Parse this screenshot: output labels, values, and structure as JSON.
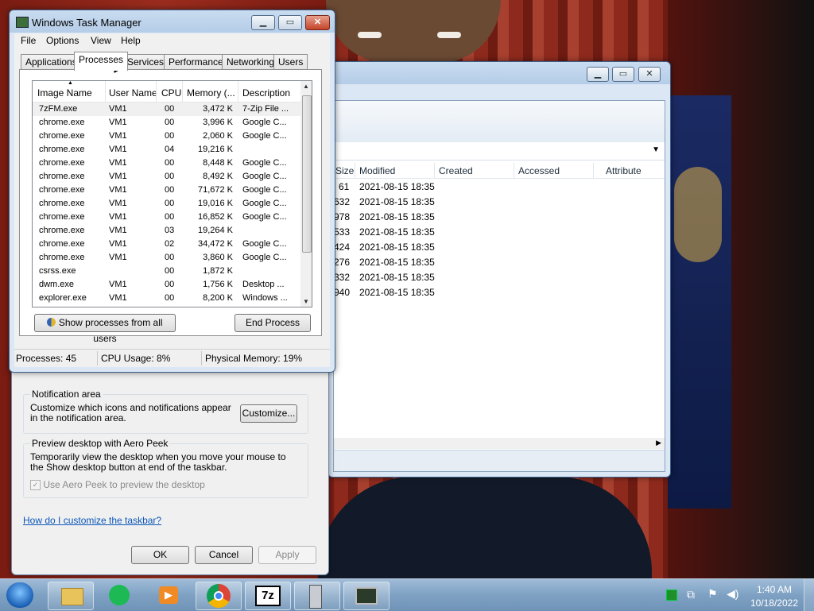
{
  "explorer": {
    "columns": [
      "Size",
      "Modified",
      "Created",
      "Accessed",
      "Attribute"
    ],
    "rows": [
      {
        "size": "61",
        "modified": "2021-08-15 18:35"
      },
      {
        "size": "632",
        "modified": "2021-08-15 18:35"
      },
      {
        "size": "978",
        "modified": "2021-08-15 18:35"
      },
      {
        "size": "533",
        "modified": "2021-08-15 18:35"
      },
      {
        "size": "424",
        "modified": "2021-08-15 18:35"
      },
      {
        "size": "276",
        "modified": "2021-08-15 18:35"
      },
      {
        "size": "332",
        "modified": "2021-08-15 18:35"
      },
      {
        "size": "940",
        "modified": "2021-08-15 18:35"
      }
    ]
  },
  "props": {
    "notification": {
      "label": "Notification area",
      "text": "Customize which icons and notifications appear in the notification area.",
      "button": "Customize..."
    },
    "peek": {
      "label": "Preview desktop with Aero Peek",
      "text": "Temporarily view the desktop when you move your mouse to the Show desktop button at end of the taskbar.",
      "checkbox": "Use Aero Peek to preview the desktop"
    },
    "help_link": "How do I customize the taskbar?",
    "ok": "OK",
    "cancel": "Cancel",
    "apply": "Apply"
  },
  "tm": {
    "title": "Windows Task Manager",
    "menu": [
      "File",
      "Options",
      "View",
      "Help"
    ],
    "tabs": [
      "Applications",
      "Processes",
      "Services",
      "Performance",
      "Networking",
      "Users"
    ],
    "columns": [
      "Image Name",
      "User Name",
      "CPU",
      "Memory (...",
      "Description"
    ],
    "processes": [
      {
        "name": "7zFM.exe",
        "user": "VM1",
        "cpu": "00",
        "mem": "3,472 K",
        "desc": "7-Zip File ..."
      },
      {
        "name": "chrome.exe",
        "user": "VM1",
        "cpu": "00",
        "mem": "3,996 K",
        "desc": "Google C..."
      },
      {
        "name": "chrome.exe",
        "user": "VM1",
        "cpu": "00",
        "mem": "2,060 K",
        "desc": "Google C..."
      },
      {
        "name": "chrome.exe",
        "user": "VM1",
        "cpu": "04",
        "mem": "19,216 K",
        "desc": ""
      },
      {
        "name": "chrome.exe",
        "user": "VM1",
        "cpu": "00",
        "mem": "8,448 K",
        "desc": "Google C..."
      },
      {
        "name": "chrome.exe",
        "user": "VM1",
        "cpu": "00",
        "mem": "8,492 K",
        "desc": "Google C..."
      },
      {
        "name": "chrome.exe",
        "user": "VM1",
        "cpu": "00",
        "mem": "71,672 K",
        "desc": "Google C..."
      },
      {
        "name": "chrome.exe",
        "user": "VM1",
        "cpu": "00",
        "mem": "19,016 K",
        "desc": "Google C..."
      },
      {
        "name": "chrome.exe",
        "user": "VM1",
        "cpu": "00",
        "mem": "16,852 K",
        "desc": "Google C..."
      },
      {
        "name": "chrome.exe",
        "user": "VM1",
        "cpu": "03",
        "mem": "19,264 K",
        "desc": ""
      },
      {
        "name": "chrome.exe",
        "user": "VM1",
        "cpu": "02",
        "mem": "34,472 K",
        "desc": "Google C..."
      },
      {
        "name": "chrome.exe",
        "user": "VM1",
        "cpu": "00",
        "mem": "3,860 K",
        "desc": "Google C..."
      },
      {
        "name": "csrss.exe",
        "user": "",
        "cpu": "00",
        "mem": "1,872 K",
        "desc": ""
      },
      {
        "name": "dwm.exe",
        "user": "VM1",
        "cpu": "00",
        "mem": "1,756 K",
        "desc": "Desktop ..."
      },
      {
        "name": "explorer.exe",
        "user": "VM1",
        "cpu": "00",
        "mem": "8,200 K",
        "desc": "Windows ..."
      }
    ],
    "show_all_button": "Show processes from all users",
    "end_process_button": "End Process",
    "status": {
      "processes": "Processes: 45",
      "cpu": "CPU Usage: 8%",
      "memory": "Physical Memory: 19%"
    }
  },
  "taskbar": {
    "apps": [
      "start-orb",
      "file-explorer",
      "spotify",
      "media-player",
      "chrome",
      "7-zip",
      "server-manager",
      "task-manager"
    ],
    "time": "1:40 AM",
    "date": "10/18/2022"
  }
}
